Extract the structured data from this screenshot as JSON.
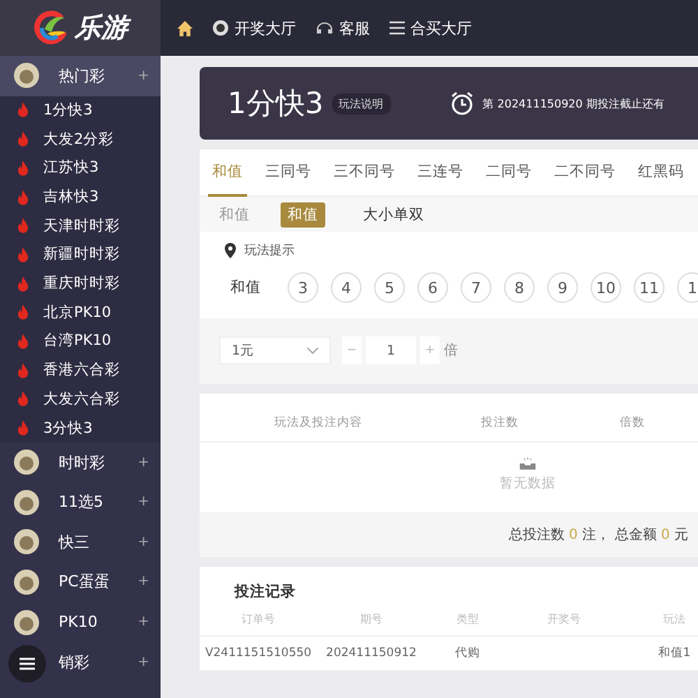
{
  "logo": {
    "text": "乐游"
  },
  "nav": [
    {
      "kind": "home"
    },
    {
      "kind": "ball",
      "label": "开奖大厅"
    },
    {
      "kind": "service",
      "label": "客服"
    },
    {
      "kind": "list",
      "label": "合买大厅"
    }
  ],
  "sidebar": {
    "groups": [
      {
        "label": "热门彩",
        "toggle": "+",
        "expanded": true,
        "children": [
          {
            "label": "1分快3"
          },
          {
            "label": "大发2分彩"
          },
          {
            "label": "江苏快3"
          },
          {
            "label": "吉林快3"
          },
          {
            "label": "天津时时彩"
          },
          {
            "label": "新疆时时彩"
          },
          {
            "label": "重庆时时彩"
          },
          {
            "label": "北京PK10"
          },
          {
            "label": "台湾PK10"
          },
          {
            "label": "香港六合彩"
          },
          {
            "label": "大发六合彩"
          },
          {
            "label": "3分快3"
          }
        ]
      },
      {
        "label": "时时彩",
        "toggle": "+",
        "expanded": false
      },
      {
        "label": "11选5",
        "toggle": "+",
        "expanded": false
      },
      {
        "label": "快三",
        "toggle": "+",
        "expanded": false
      },
      {
        "label": "PC蛋蛋",
        "toggle": "+",
        "expanded": false
      },
      {
        "label": "PK10",
        "toggle": "+",
        "expanded": false
      },
      {
        "label": "销彩",
        "toggle": "+",
        "expanded": false
      }
    ]
  },
  "game": {
    "title": "1分快3",
    "rules_button": "玩法说明",
    "period_prefix": "第",
    "period": "202411150920",
    "period_suffix": "期投注截止还有"
  },
  "tabs": [
    {
      "label": "和值",
      "selected": true
    },
    {
      "label": "三同号",
      "selected": false
    },
    {
      "label": "三不同号",
      "selected": false
    },
    {
      "label": "三连号",
      "selected": false
    },
    {
      "label": "二同号",
      "selected": false
    },
    {
      "label": "二不同号",
      "selected": false
    },
    {
      "label": "红黑码",
      "selected": false
    }
  ],
  "subtabs": {
    "label": "和值",
    "items": [
      {
        "label": "和值",
        "selected": true
      },
      {
        "label": "大小单双",
        "selected": false
      }
    ]
  },
  "hint": "玩法提示",
  "numbers": {
    "label": "和值",
    "balls": [
      "3",
      "4",
      "5",
      "6",
      "7",
      "8",
      "9",
      "10",
      "11",
      "1"
    ]
  },
  "bet": {
    "unit": "1元",
    "multiplier": "1",
    "minus": "−",
    "plus": "+",
    "multiplier_suffix": "倍"
  },
  "cart": {
    "columns": [
      "玩法及投注内容",
      "投注数",
      "倍数"
    ],
    "empty": "暂无数据",
    "total_label": "总投注数",
    "total_count": "0",
    "total_unit": "注，",
    "amount_label": "总金额",
    "amount": "0",
    "amount_unit": "元"
  },
  "records": {
    "title": "投注记录",
    "columns": [
      "订单号",
      "期号",
      "类型",
      "开奖号",
      "玩法"
    ],
    "rows": [
      [
        "V2411151510550",
        "202411150912",
        "代购",
        "",
        "和值1"
      ]
    ]
  }
}
